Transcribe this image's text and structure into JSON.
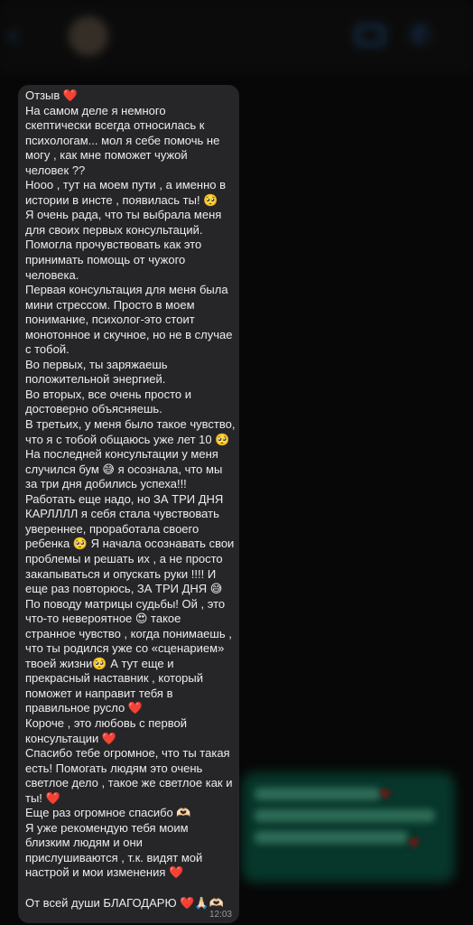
{
  "message": {
    "lines": [
      "Отзыв ❤️",
      "На самом деле я немного",
      "скептически всегда относилась к",
      "психологам... мол я себе помочь не",
      "могу , как мне поможет чужой",
      "человек ??",
      "Нооо , тут на моем пути , а именно в",
      "истории в инсте , появилась ты! 🥺",
      "Я очень рада, что ты выбрала меня",
      "для своих первых консультаций.",
      "Помогла прочувствовать как это",
      "принимать помощь от чужого",
      "человека.",
      "Первая консультация для меня была",
      "мини стрессом. Просто в моем",
      "понимание, психолог-это стоит",
      "монотонное и скучное, но не в случае",
      "с тобой.",
      "Во первых, ты заряжаешь",
      "положительной энергией.",
      "Во вторых, все очень просто и",
      "достоверно объясняешь.",
      "В третьих, у меня было такое чувство,",
      "что я с тобой общаюсь уже лет 10 🥺",
      "На последней консультации у меня",
      "случился бум 😅 я осознала, что мы",
      "за три дня добились успеха!!!",
      "Работать еще надо, но ЗА ТРИ ДНЯ",
      "КАРЛЛЛЛ я себя стала чувствовать",
      "увереннее, проработала своего",
      "ребенка 🥺 Я начала осознавать свои",
      "проблемы и решать их , а не просто",
      "закапываться и опускать руки !!!! И",
      "еще раз повторюсь, ЗА ТРИ ДНЯ 😅",
      "По поводу матрицы судьбы! Ой , это",
      "что-то невероятное 😍 такое",
      "странное чувство , когда понимаешь ,",
      "что ты родился уже со «сценарием»",
      "твоей жизни🥺 А тут еще и",
      "прекрасный наставник , который",
      "поможет и направит тебя в",
      "правильное русло ❤️",
      "Короче , это любовь с первой",
      "консультации ❤️",
      "Спасибо тебе огромное, что ты такая",
      "есть! Помогать людям это очень",
      "светлое дело , такое же светлое как и",
      "ты! ❤️",
      "Еще раз огромное спасибо 🫶🏻",
      "Я уже рекомендую тебя моим",
      "близким людям и они",
      "прислушиваются , т.к. видят мой",
      "настрой и мои изменения ❤️",
      "",
      "От всей души БЛАГОДАРЮ ❤️🙏🏻🫶🏻"
    ],
    "time": "12:03"
  },
  "colors": {
    "background": "#070707",
    "bubble": "#262628",
    "text": "#ededed",
    "time": "#9a9a9c",
    "blurred_outgoing_bubble": "#073f31",
    "accent": "#1d4f86"
  },
  "icons": {
    "back": "chevron-left-icon",
    "video": "video-call-icon",
    "call": "phone-icon"
  }
}
